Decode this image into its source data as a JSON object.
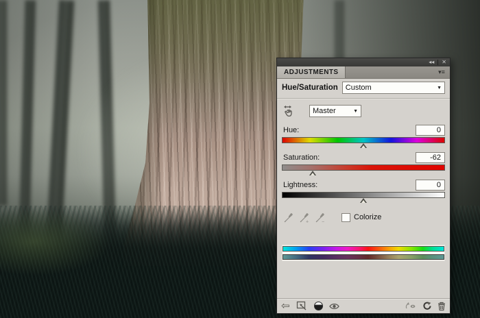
{
  "panel": {
    "window_controls": {
      "collapse_glyph": "◂◂",
      "close_glyph": "✕"
    },
    "tab": {
      "label": "ADJUSTMENTS"
    },
    "panel_menu_glyph": "▾≡",
    "adjustment_title": "Hue/Saturation",
    "preset_dropdown": {
      "value": "Custom"
    },
    "channel_dropdown": {
      "value": "Master"
    },
    "dropdown_arrow_glyph": "▼",
    "sliders": [
      {
        "label": "Hue:",
        "value": "0",
        "marker_style": "left:50%"
      },
      {
        "label": "Saturation:",
        "value": "-62",
        "marker_style": "left:19%"
      },
      {
        "label": "Lightness:",
        "value": "0",
        "marker_style": "left:50%"
      }
    ],
    "eyedroppers": {
      "add_glyph": "+",
      "subtract_glyph": "−"
    },
    "colorize": {
      "label": "Colorize",
      "checked": false
    },
    "colors": {
      "panel_background": "#d5d2cd",
      "titlebar": "#3a3a38",
      "tab_background": "#b6b3ad",
      "field_background": "#fdfdfa",
      "field_border": "#84817a"
    }
  }
}
